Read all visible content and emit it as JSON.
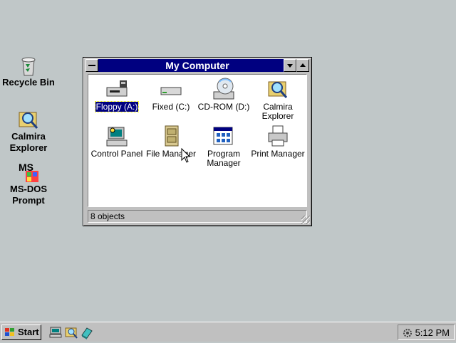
{
  "desktop": {
    "icons": [
      {
        "label": "Recycle Bin",
        "icon": "recycle-bin-icon"
      },
      {
        "label": "Calmira Explorer",
        "icon": "calmira-explorer-icon"
      },
      {
        "label": "MS-DOS Prompt",
        "icon": "ms-dos-prompt-icon"
      }
    ]
  },
  "window": {
    "title": "My Computer",
    "items": [
      {
        "label": "Floppy (A:)",
        "icon": "floppy-drive-icon",
        "selected": true
      },
      {
        "label": "Fixed (C:)",
        "icon": "hard-drive-icon"
      },
      {
        "label": "CD-ROM (D:)",
        "icon": "cdrom-drive-icon"
      },
      {
        "label": "Calmira Explorer",
        "icon": "calmira-explorer-icon"
      },
      {
        "label": "Control Panel",
        "icon": "control-panel-icon"
      },
      {
        "label": "File Manager",
        "icon": "file-manager-icon"
      },
      {
        "label": "Program Manager",
        "icon": "program-manager-icon"
      },
      {
        "label": "Print Manager",
        "icon": "print-manager-icon"
      }
    ],
    "status": "8 objects"
  },
  "taskbar": {
    "start_label": "Start",
    "quicklaunch": [
      "computer-icon",
      "explorer-icon",
      "help-icon"
    ],
    "clock": "5:12 PM"
  },
  "colors": {
    "desktop": "#c0c7c8",
    "titlebar": "#000080",
    "selection": "#000080"
  }
}
